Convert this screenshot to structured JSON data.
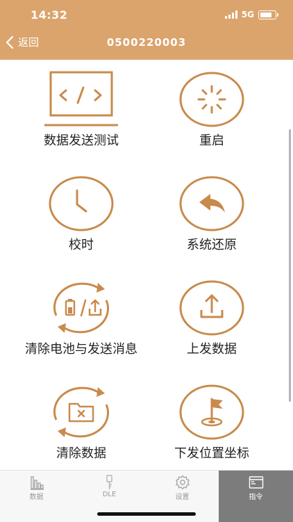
{
  "status_bar": {
    "time": "14:32",
    "network": "5G"
  },
  "header": {
    "back_label": "返回",
    "title": "0500220003"
  },
  "colors": {
    "accent": "#dba46d",
    "icon_stroke": "#c98a4b",
    "active_tab": "#7c7c7c"
  },
  "commands": [
    {
      "label": "数据发送测试",
      "icon": "monitor-code-icon"
    },
    {
      "label": "重启",
      "icon": "restart-spinner-icon"
    },
    {
      "label": "校时",
      "icon": "clock-icon"
    },
    {
      "label": "系统还原",
      "icon": "reply-arrow-icon"
    },
    {
      "label": "清除电池与发送消息",
      "icon": "battery-upload-refresh-icon"
    },
    {
      "label": "上发数据",
      "icon": "upload-icon"
    },
    {
      "label": "清除数据",
      "icon": "folder-clear-refresh-icon"
    },
    {
      "label": "下发位置坐标",
      "icon": "flag-location-icon"
    }
  ],
  "tabs": [
    {
      "label": "数据",
      "icon": "bar-chart-icon",
      "active": false
    },
    {
      "label": "DLE",
      "icon": "key-icon",
      "active": false
    },
    {
      "label": "设置",
      "icon": "gear-icon",
      "active": false
    },
    {
      "label": "指令",
      "icon": "terminal-icon",
      "active": true
    }
  ]
}
